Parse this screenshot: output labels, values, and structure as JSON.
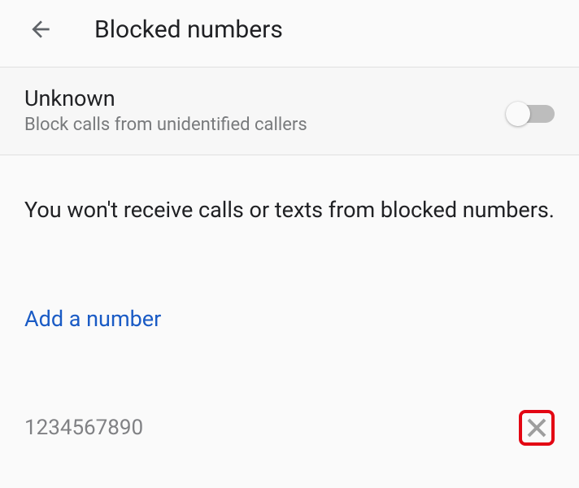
{
  "header": {
    "title": "Blocked numbers"
  },
  "unknown_toggle": {
    "title": "Unknown",
    "subtitle": "Block calls from unidentified callers",
    "enabled": false
  },
  "info_text": "You won't receive calls or texts from blocked numbers.",
  "add_label": "Add a number",
  "numbers": [
    {
      "value": "1234567890"
    }
  ]
}
